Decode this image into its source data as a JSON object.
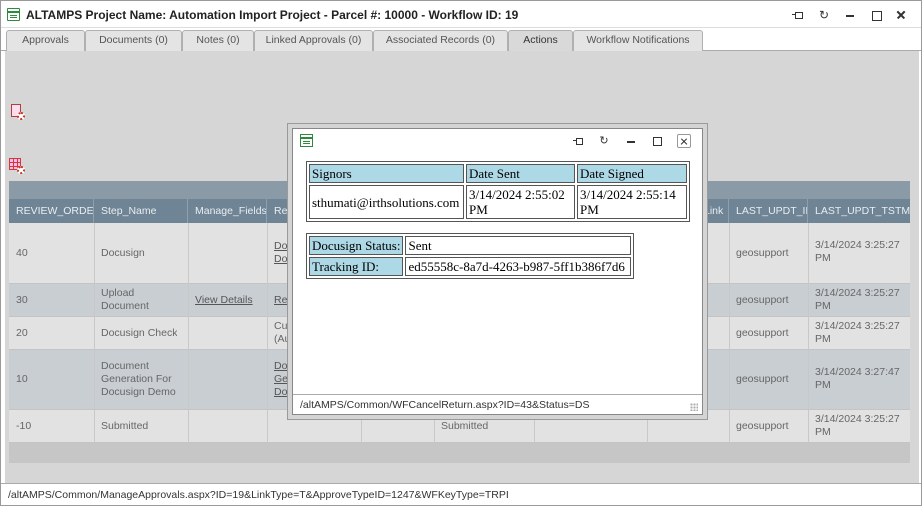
{
  "window": {
    "title": "ALTAMPS Project Name: Automation Import Project - Parcel #: 10000 - Workflow ID: 19",
    "status_url": "/altAMPS/Common/ManageApprovals.aspx?ID=19&LinkType=T&ApproveTypeID=1247&WFKeyType=TRPI"
  },
  "tabs": [
    {
      "label": "Approvals"
    },
    {
      "label": "Documents (0)"
    },
    {
      "label": "Notes (0)"
    },
    {
      "label": "Linked Approvals (0)"
    },
    {
      "label": "Associated Records (0)"
    },
    {
      "label": "Actions",
      "active": true
    },
    {
      "label": "Workflow Notifications"
    }
  ],
  "grid": {
    "columns": [
      "REVIEW_ORDER",
      "Step_Name",
      "Manage_Fields",
      "Revi",
      "",
      "",
      "",
      "Link",
      "LAST_UPDT_ID",
      "LAST_UPDT_TSTMP"
    ],
    "rows": [
      {
        "order": "40",
        "step": "Docusign",
        "manage": "",
        "review": [
          "Docu",
          "Docu"
        ],
        "status": "",
        "updt_id": "geosupport",
        "tstmp": "3/14/2024 3:25:27 PM"
      },
      {
        "order": "30",
        "step": "Upload Document",
        "manage": "View Details",
        "review": [
          "Requ"
        ],
        "status": "",
        "updt_id": "geosupport",
        "tstmp": "3/14/2024 3:25:27 PM"
      },
      {
        "order": "20",
        "step": "Docusign Check",
        "manage": "",
        "review": [
          "Cust",
          "(Auto"
        ],
        "status": "",
        "updt_id": "geosupport",
        "tstmp": "3/14/2024 3:25:27 PM"
      },
      {
        "order": "10",
        "step": "Document Generation For Docusign Demo",
        "manage": "",
        "review": [
          "Docu",
          "Gene",
          "Docu"
        ],
        "status": "",
        "updt_id": "geosupport",
        "tstmp": "3/14/2024 3:27:47 PM"
      },
      {
        "order": "-10",
        "step": "Submitted",
        "manage": "",
        "review": [],
        "status": "Submitted",
        "updt_id": "geosupport",
        "tstmp": "3/14/2024 3:25:27 PM"
      }
    ]
  },
  "modal": {
    "signors_table": {
      "headers": [
        "Signors",
        "Date Sent",
        "Date Signed"
      ],
      "rows": [
        [
          "sthumati@irthsolutions.com",
          "3/14/2024 2:55:02 PM",
          "3/14/2024 2:55:14 PM"
        ]
      ]
    },
    "docusign": {
      "status_label": "Docusign Status:",
      "status_value": "Sent",
      "tracking_label": "Tracking ID:",
      "tracking_value": "ed55558c-8a7d-4263-b987-5ff1b386f7d6"
    },
    "status_url": "/altAMPS/Common/WFCancelReturn.aspx?ID=43&Status=DS"
  }
}
